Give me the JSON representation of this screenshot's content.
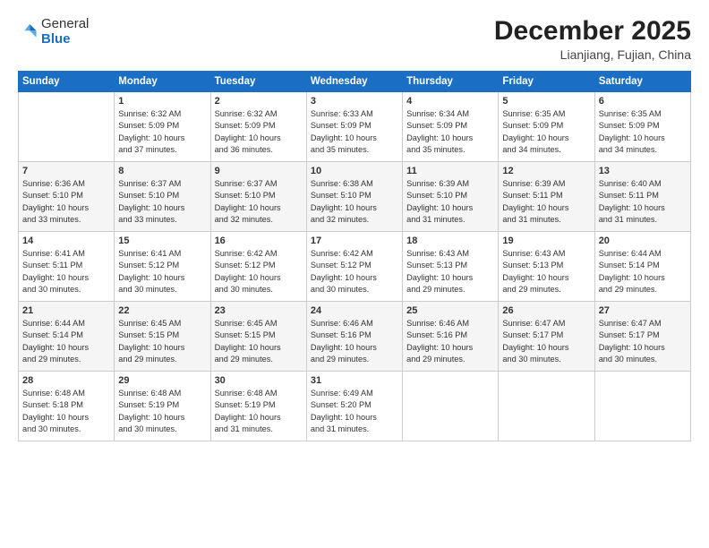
{
  "logo": {
    "general": "General",
    "blue": "Blue"
  },
  "header": {
    "month": "December 2025",
    "location": "Lianjiang, Fujian, China"
  },
  "weekdays": [
    "Sunday",
    "Monday",
    "Tuesday",
    "Wednesday",
    "Thursday",
    "Friday",
    "Saturday"
  ],
  "weeks": [
    [
      {
        "day": "",
        "info": ""
      },
      {
        "day": "1",
        "info": "Sunrise: 6:32 AM\nSunset: 5:09 PM\nDaylight: 10 hours\nand 37 minutes."
      },
      {
        "day": "2",
        "info": "Sunrise: 6:32 AM\nSunset: 5:09 PM\nDaylight: 10 hours\nand 36 minutes."
      },
      {
        "day": "3",
        "info": "Sunrise: 6:33 AM\nSunset: 5:09 PM\nDaylight: 10 hours\nand 35 minutes."
      },
      {
        "day": "4",
        "info": "Sunrise: 6:34 AM\nSunset: 5:09 PM\nDaylight: 10 hours\nand 35 minutes."
      },
      {
        "day": "5",
        "info": "Sunrise: 6:35 AM\nSunset: 5:09 PM\nDaylight: 10 hours\nand 34 minutes."
      },
      {
        "day": "6",
        "info": "Sunrise: 6:35 AM\nSunset: 5:09 PM\nDaylight: 10 hours\nand 34 minutes."
      }
    ],
    [
      {
        "day": "7",
        "info": "Sunrise: 6:36 AM\nSunset: 5:10 PM\nDaylight: 10 hours\nand 33 minutes."
      },
      {
        "day": "8",
        "info": "Sunrise: 6:37 AM\nSunset: 5:10 PM\nDaylight: 10 hours\nand 33 minutes."
      },
      {
        "day": "9",
        "info": "Sunrise: 6:37 AM\nSunset: 5:10 PM\nDaylight: 10 hours\nand 32 minutes."
      },
      {
        "day": "10",
        "info": "Sunrise: 6:38 AM\nSunset: 5:10 PM\nDaylight: 10 hours\nand 32 minutes."
      },
      {
        "day": "11",
        "info": "Sunrise: 6:39 AM\nSunset: 5:10 PM\nDaylight: 10 hours\nand 31 minutes."
      },
      {
        "day": "12",
        "info": "Sunrise: 6:39 AM\nSunset: 5:11 PM\nDaylight: 10 hours\nand 31 minutes."
      },
      {
        "day": "13",
        "info": "Sunrise: 6:40 AM\nSunset: 5:11 PM\nDaylight: 10 hours\nand 31 minutes."
      }
    ],
    [
      {
        "day": "14",
        "info": "Sunrise: 6:41 AM\nSunset: 5:11 PM\nDaylight: 10 hours\nand 30 minutes."
      },
      {
        "day": "15",
        "info": "Sunrise: 6:41 AM\nSunset: 5:12 PM\nDaylight: 10 hours\nand 30 minutes."
      },
      {
        "day": "16",
        "info": "Sunrise: 6:42 AM\nSunset: 5:12 PM\nDaylight: 10 hours\nand 30 minutes."
      },
      {
        "day": "17",
        "info": "Sunrise: 6:42 AM\nSunset: 5:12 PM\nDaylight: 10 hours\nand 30 minutes."
      },
      {
        "day": "18",
        "info": "Sunrise: 6:43 AM\nSunset: 5:13 PM\nDaylight: 10 hours\nand 29 minutes."
      },
      {
        "day": "19",
        "info": "Sunrise: 6:43 AM\nSunset: 5:13 PM\nDaylight: 10 hours\nand 29 minutes."
      },
      {
        "day": "20",
        "info": "Sunrise: 6:44 AM\nSunset: 5:14 PM\nDaylight: 10 hours\nand 29 minutes."
      }
    ],
    [
      {
        "day": "21",
        "info": "Sunrise: 6:44 AM\nSunset: 5:14 PM\nDaylight: 10 hours\nand 29 minutes."
      },
      {
        "day": "22",
        "info": "Sunrise: 6:45 AM\nSunset: 5:15 PM\nDaylight: 10 hours\nand 29 minutes."
      },
      {
        "day": "23",
        "info": "Sunrise: 6:45 AM\nSunset: 5:15 PM\nDaylight: 10 hours\nand 29 minutes."
      },
      {
        "day": "24",
        "info": "Sunrise: 6:46 AM\nSunset: 5:16 PM\nDaylight: 10 hours\nand 29 minutes."
      },
      {
        "day": "25",
        "info": "Sunrise: 6:46 AM\nSunset: 5:16 PM\nDaylight: 10 hours\nand 29 minutes."
      },
      {
        "day": "26",
        "info": "Sunrise: 6:47 AM\nSunset: 5:17 PM\nDaylight: 10 hours\nand 30 minutes."
      },
      {
        "day": "27",
        "info": "Sunrise: 6:47 AM\nSunset: 5:17 PM\nDaylight: 10 hours\nand 30 minutes."
      }
    ],
    [
      {
        "day": "28",
        "info": "Sunrise: 6:48 AM\nSunset: 5:18 PM\nDaylight: 10 hours\nand 30 minutes."
      },
      {
        "day": "29",
        "info": "Sunrise: 6:48 AM\nSunset: 5:19 PM\nDaylight: 10 hours\nand 30 minutes."
      },
      {
        "day": "30",
        "info": "Sunrise: 6:48 AM\nSunset: 5:19 PM\nDaylight: 10 hours\nand 31 minutes."
      },
      {
        "day": "31",
        "info": "Sunrise: 6:49 AM\nSunset: 5:20 PM\nDaylight: 10 hours\nand 31 minutes."
      },
      {
        "day": "",
        "info": ""
      },
      {
        "day": "",
        "info": ""
      },
      {
        "day": "",
        "info": ""
      }
    ]
  ]
}
